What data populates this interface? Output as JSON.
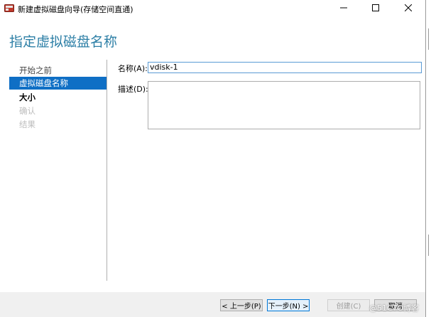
{
  "window": {
    "title": "新建虚拟磁盘向导(存储空间直通)",
    "app_icon": "disk-wizard-icon",
    "controls": {
      "minimize_icon": "minimize-icon",
      "maximize_icon": "maximize-icon",
      "close_icon": "close-icon"
    }
  },
  "header": {
    "page_title": "指定虚拟磁盘名称"
  },
  "nav": {
    "items": [
      {
        "label": "开始之前",
        "state": "normal"
      },
      {
        "label": "虚拟磁盘名称",
        "state": "current"
      },
      {
        "label": "大小",
        "state": "bold"
      },
      {
        "label": "确认",
        "state": "disabled"
      },
      {
        "label": "结果",
        "state": "disabled"
      }
    ]
  },
  "form": {
    "name_label": "名称(A):",
    "name_value": "vdisk-1",
    "description_label": "描述(D):",
    "description_value": ""
  },
  "footer": {
    "prev_label": "< 上一步(P)",
    "next_label": "下一步(N) >",
    "create_label": "创建(C)",
    "cancel_label": "取消"
  },
  "watermark": "@51CTO博客",
  "colors": {
    "accent": "#2d7fa6",
    "selection": "#0f6fc5",
    "primary_border": "#0078d7"
  }
}
